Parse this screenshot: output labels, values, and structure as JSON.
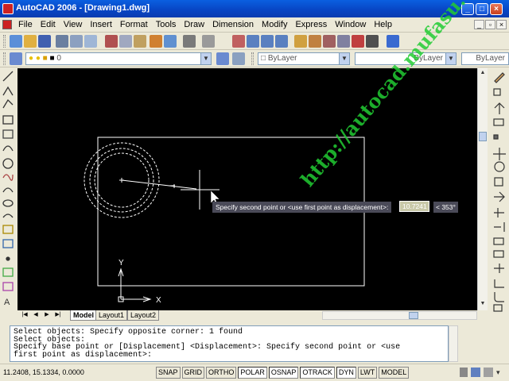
{
  "window": {
    "title": "AutoCAD 2006 - [Drawing1.dwg]",
    "minimize": "_",
    "maximize": "□",
    "close": "×"
  },
  "menu": [
    "File",
    "Edit",
    "View",
    "Insert",
    "Format",
    "Tools",
    "Draw",
    "Dimension",
    "Modify",
    "Express",
    "Window",
    "Help"
  ],
  "layers": {
    "layer_value": "0",
    "color_value": "ByLayer",
    "linetype_value": "ByLayer",
    "lineweight_value": "ByLayer"
  },
  "tabs": {
    "model": "Model",
    "layout1": "Layout1",
    "layout2": "Layout2"
  },
  "ucs": {
    "x_label": "X",
    "y_label": "Y"
  },
  "dynamic_input": {
    "prompt": "Specify second point or <use first point as displacement>:",
    "distance": "10.7241",
    "angle": "< 353°"
  },
  "command_history": [
    "Select objects: Specify opposite corner: 1 found",
    "Select objects:",
    "Specify base point or [Displacement] <Displacement>: Specify second point or <use",
    "first point as displacement>:"
  ],
  "status": {
    "coordinates": "11.2408, 15.1334, 0.0000",
    "buttons": [
      "SNAP",
      "GRID",
      "ORTHO",
      "POLAR",
      "OSNAP",
      "OTRACK",
      "DYN",
      "LWT",
      "MODEL"
    ]
  },
  "watermark": "http://autocad.mufasu.com",
  "colors": {
    "titlebar": "#0a5fe0",
    "canvas": "#000000",
    "entities": "#ffffff",
    "tooltip": "#4a4a58",
    "watermark": "#22cc33"
  }
}
